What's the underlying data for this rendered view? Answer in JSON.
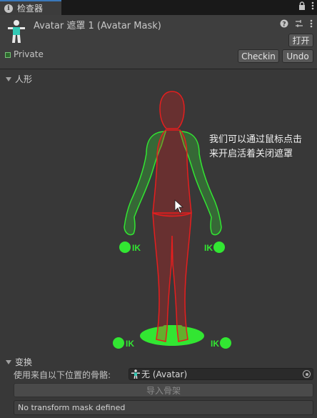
{
  "tab": {
    "label": "检查器"
  },
  "header": {
    "title": "Avatar 遮罩 1 (Avatar Mask)",
    "open_label": "打开",
    "private_label": "Private",
    "checkin_label": "Checkin",
    "undo_label": "Undo"
  },
  "humanoid": {
    "title": "人形",
    "annotation_line1": "我们可以通过鼠标点击",
    "annotation_line2": "来开启活着关闭遮罩",
    "ik_label": "IK"
  },
  "transform": {
    "title": "变换",
    "source_label": "使用来自以下位置的骨骼:",
    "source_value": "无 (Avatar)",
    "import_label": "导入骨架",
    "help_text": "No transform mask defined"
  },
  "colors": {
    "enabled": "#32e632",
    "disabled": "#e61e1e",
    "accent": "#3a79bb"
  }
}
